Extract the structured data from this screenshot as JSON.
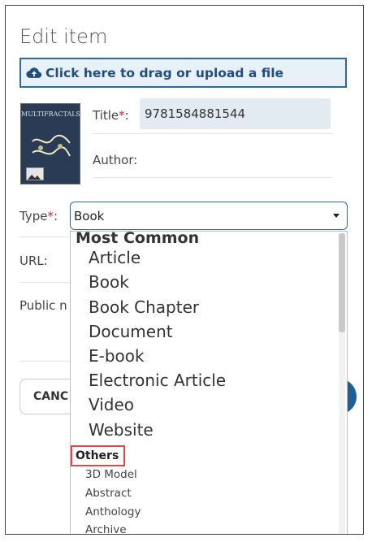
{
  "header": {
    "title": "Edit item"
  },
  "upload": {
    "label": "Click here to drag or upload a file"
  },
  "cover": {
    "title_text": "MULTIFRACTALS"
  },
  "form": {
    "title_label": "Title",
    "title_value": "9781584881544",
    "author_label": "Author:",
    "type_label": "Type",
    "type_value": "Book",
    "url_label": "URL:",
    "public_label": "Public n",
    "required_mark": "*",
    "colon": ":"
  },
  "buttons": {
    "cancel": "CANC"
  },
  "dropdown": {
    "group_most_common": "Most Common",
    "most_common": [
      "Article",
      "Book",
      "Book Chapter",
      "Document",
      "E-book",
      "Electronic Article",
      "Video",
      "Website"
    ],
    "group_others": "Others",
    "others": [
      "3D Model",
      "Abstract",
      "Anthology",
      "Archive"
    ]
  },
  "colors": {
    "accent": "#2d6a9f",
    "required": "#d0243a",
    "highlight_box": "#e0464a"
  },
  "icons": {
    "upload": "cloud-upload-icon",
    "caret": "caret-down-icon",
    "image": "image-icon"
  }
}
